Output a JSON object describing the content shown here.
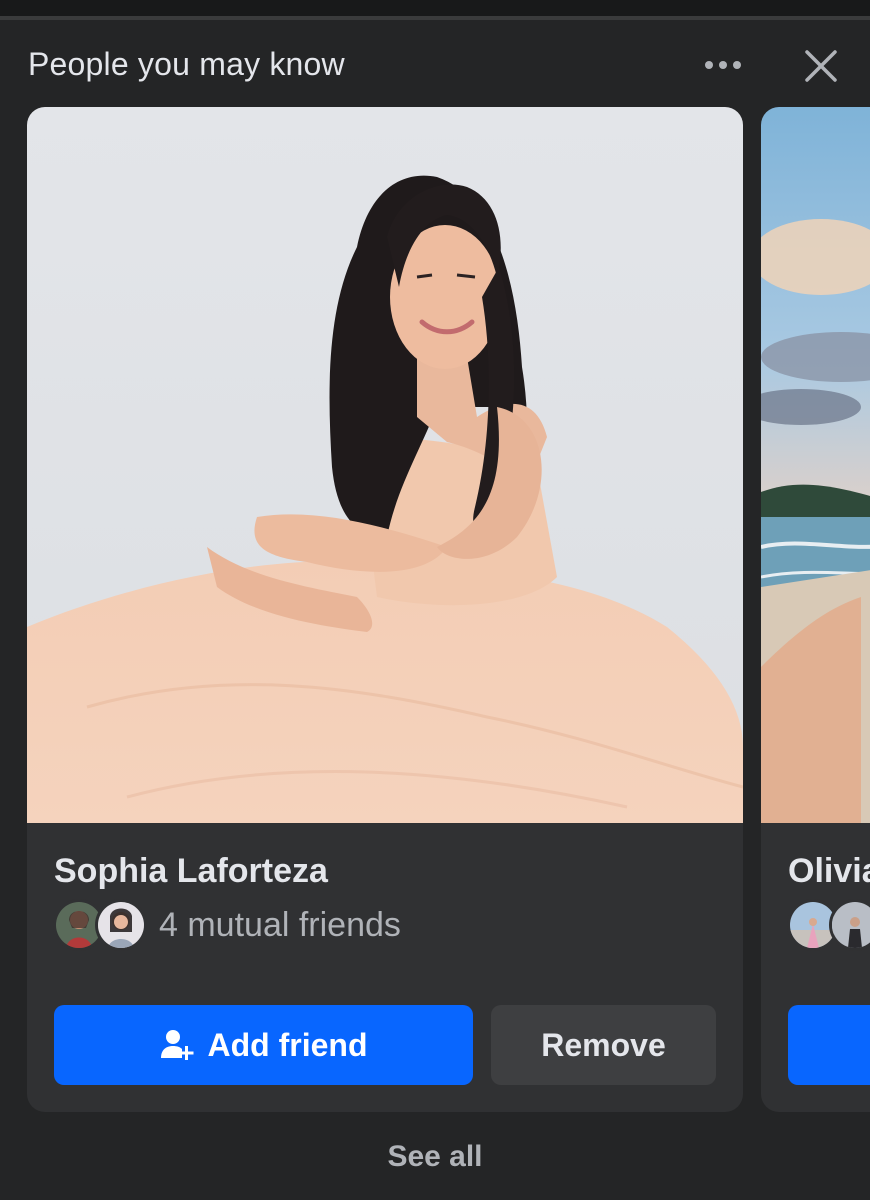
{
  "header": {
    "title": "People you may know",
    "more_icon": "more-horizontal-icon",
    "close_icon": "close-icon"
  },
  "suggestions": [
    {
      "name": "Sophia Laforteza",
      "mutual_text": "4 mutual friends",
      "add_label": "Add friend",
      "add_icon": "add-person-icon",
      "remove_label": "Remove"
    },
    {
      "name": "Olivia",
      "mutual_text": "",
      "add_label": ""
    }
  ],
  "footer": {
    "see_all_label": "See all"
  },
  "colors": {
    "background": "#242526",
    "card": "#303133",
    "primary": "#0866ff",
    "secondary_button": "#3e3f41",
    "text_primary": "#e4e6eb",
    "text_secondary": "#b0b3b8"
  }
}
